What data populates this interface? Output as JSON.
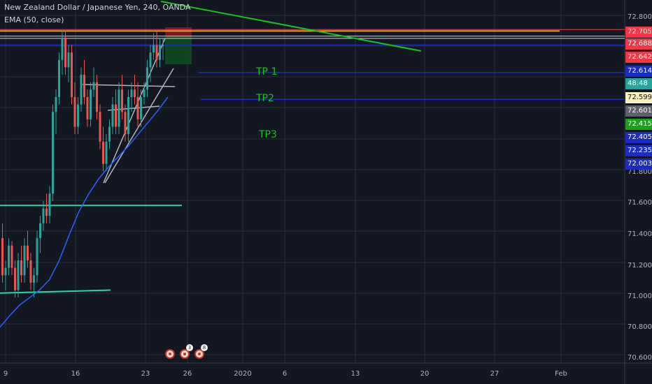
{
  "legend": {
    "symbol_line": "New Zealand Dollar / Japanese Yen, 240, OANDA",
    "indicator_line": "EMA (50, close)"
  },
  "targets": [
    {
      "label": "TP 1",
      "price": 72.614
    },
    {
      "label": "TP2",
      "price": 72.415
    },
    {
      "label": "TP3",
      "price": 72.003
    }
  ],
  "price_tags": [
    {
      "text": "72.705",
      "price": 72.705,
      "bg": "#f23645",
      "fg": "#ffffff"
    },
    {
      "text": "72.688",
      "price": 72.688,
      "bg": "#f23645",
      "fg": "#ffffff"
    },
    {
      "text": "72.642",
      "price": 72.642,
      "bg": "#f23645",
      "fg": "#ffffff"
    },
    {
      "text": "72.614",
      "price": 72.614,
      "bg": "#1a2cc4",
      "fg": "#ffffff"
    },
    {
      "text": "48:48",
      "price": 72.608,
      "bg": "#26a69a",
      "fg": "#ffffff"
    },
    {
      "text": "72.599",
      "price": 72.599,
      "bg": "#f7f0c0",
      "fg": "#131722"
    },
    {
      "text": "72.601",
      "price": 72.601,
      "bg": "#5d606b",
      "fg": "#ffffff"
    },
    {
      "text": "72.415",
      "price": 72.415,
      "bg": "#1ea01e",
      "fg": "#ffffff"
    },
    {
      "text": "72.405",
      "price": 72.405,
      "bg": "#1a2cc4",
      "fg": "#ffffff"
    },
    {
      "text": "72.235",
      "price": 72.235,
      "bg": "#1a2cc4",
      "fg": "#ffffff"
    },
    {
      "text": "72.003",
      "price": 72.003,
      "bg": "#1a2cc4",
      "fg": "#ffffff"
    }
  ],
  "events": [
    {
      "count": ""
    },
    {
      "count": "3"
    },
    {
      "count": "8"
    }
  ],
  "colors": {
    "background": "#131722",
    "grid": "#2a2e39",
    "up": "#26a69a",
    "down": "#ef5350",
    "ema": "#2962ff",
    "target_line": "#1a2cc4",
    "support_line": "#26d9a0",
    "trend_line": "#19c219",
    "wedge_line": "#b2b5be",
    "stop_zone": "#8b1a1a",
    "profit_zone": "#0f4a1f"
  },
  "chart_data": {
    "type": "candlestick",
    "title": "New Zealand Dollar / Japanese Yen, 240, OANDA",
    "indicator": "EMA (50, close)",
    "ylim": [
      70.55,
      72.82
    ],
    "y_ticks": [
      "72.800",
      "71.800",
      "71.600",
      "71.400",
      "71.200",
      "71.000",
      "70.800",
      "70.600"
    ],
    "x_ticks": [
      "9",
      "16",
      "23",
      "26",
      "2020",
      "6",
      "13",
      "20",
      "27",
      "Feb"
    ],
    "grid": true,
    "candles": [
      [
        71.3,
        71.4,
        71.0,
        71.05
      ],
      [
        71.05,
        71.15,
        70.95,
        71.1
      ],
      [
        71.1,
        71.3,
        71.05,
        71.25
      ],
      [
        71.25,
        71.28,
        71.05,
        71.1
      ],
      [
        71.1,
        71.15,
        70.9,
        70.95
      ],
      [
        70.95,
        71.2,
        70.9,
        71.15
      ],
      [
        71.15,
        71.25,
        71.0,
        71.05
      ],
      [
        71.05,
        71.3,
        71.0,
        71.25
      ],
      [
        71.25,
        71.35,
        71.1,
        71.15
      ],
      [
        71.15,
        71.2,
        70.95,
        71.0
      ],
      [
        71.0,
        71.1,
        70.9,
        71.05
      ],
      [
        71.05,
        71.35,
        71.0,
        71.3
      ],
      [
        71.3,
        71.45,
        71.2,
        71.4
      ],
      [
        71.4,
        71.55,
        71.35,
        71.5
      ],
      [
        71.5,
        71.6,
        71.4,
        71.45
      ],
      [
        71.45,
        71.65,
        71.4,
        71.6
      ],
      [
        71.6,
        72.2,
        71.55,
        72.15
      ],
      [
        72.15,
        72.3,
        72.0,
        72.25
      ],
      [
        72.25,
        72.55,
        72.2,
        72.5
      ],
      [
        72.5,
        72.7,
        72.4,
        72.65
      ],
      [
        72.65,
        72.7,
        72.4,
        72.45
      ],
      [
        72.45,
        72.6,
        72.35,
        72.55
      ],
      [
        72.55,
        72.6,
        72.2,
        72.25
      ],
      [
        72.25,
        72.35,
        72.0,
        72.05
      ],
      [
        72.05,
        72.25,
        72.0,
        72.2
      ],
      [
        72.2,
        72.45,
        72.15,
        72.4
      ],
      [
        72.4,
        72.5,
        72.2,
        72.25
      ],
      [
        72.25,
        72.3,
        72.05,
        72.1
      ],
      [
        72.1,
        72.35,
        72.05,
        72.3
      ],
      [
        72.3,
        72.45,
        72.25,
        72.35
      ],
      [
        72.35,
        72.4,
        72.1,
        72.15
      ],
      [
        72.15,
        72.2,
        71.9,
        71.95
      ],
      [
        71.95,
        72.05,
        71.75,
        71.8
      ],
      [
        71.8,
        72.0,
        71.75,
        71.95
      ],
      [
        71.95,
        72.1,
        71.9,
        72.05
      ],
      [
        72.05,
        72.25,
        72.0,
        72.2
      ],
      [
        72.2,
        72.3,
        72.0,
        72.05
      ],
      [
        72.05,
        72.35,
        72.0,
        72.3
      ],
      [
        72.3,
        72.4,
        72.1,
        72.15
      ],
      [
        72.15,
        72.2,
        71.95,
        72.0
      ],
      [
        72.0,
        72.3,
        71.95,
        72.25
      ],
      [
        72.25,
        72.35,
        72.15,
        72.3
      ],
      [
        72.3,
        72.4,
        72.2,
        72.25
      ],
      [
        72.25,
        72.35,
        72.05,
        72.1
      ],
      [
        72.1,
        72.3,
        72.05,
        72.25
      ],
      [
        72.25,
        72.35,
        72.2,
        72.3
      ],
      [
        72.3,
        72.5,
        72.25,
        72.45
      ],
      [
        72.45,
        72.6,
        72.35,
        72.55
      ],
      [
        72.55,
        72.68,
        72.5,
        72.6
      ],
      [
        72.6,
        72.7,
        72.45,
        72.5
      ],
      [
        72.5,
        72.65,
        72.45,
        72.6
      ],
      [
        72.6,
        72.65,
        72.5,
        72.6
      ]
    ],
    "ema": [
      70.7,
      70.78,
      70.85,
      70.9,
      70.95,
      71.02,
      71.15,
      71.32,
      71.48,
      71.6,
      71.7,
      71.78,
      71.85,
      71.92,
      72.0,
      72.08,
      72.16,
      72.25
    ],
    "levels": [
      {
        "name": "TP 1",
        "price": 72.614
      },
      {
        "name": "TP2",
        "price": 72.415
      },
      {
        "name": "TP3",
        "price": 72.003
      },
      {
        "name": "support-upper",
        "price": 71.52
      },
      {
        "name": "support-lower",
        "price": 70.93
      }
    ]
  }
}
